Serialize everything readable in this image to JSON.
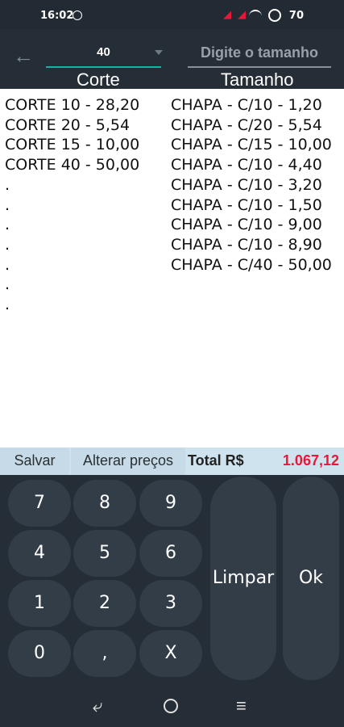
{
  "status": {
    "time": "16:02",
    "battery": "70"
  },
  "topbar": {
    "back_icon": "arrow-left-icon",
    "selected_value": "40",
    "size_placeholder": "Digite o tamanho"
  },
  "headers": {
    "corte": "Corte",
    "tamanho": "Tamanho"
  },
  "corte_items": [
    "CORTE 10 - 28,20",
    "CORTE 20 - 5,54",
    "CORTE 15 - 10,00",
    "CORTE 40 - 50,00",
    ".",
    ".",
    ".",
    ".",
    ".",
    ".",
    "."
  ],
  "tamanho_items": [
    "CHAPA - C/10 - 1,20",
    "CHAPA - C/20 - 5,54",
    "CHAPA - C/15 - 10,00",
    "CHAPA - C/10 - 4,40",
    "CHAPA - C/10 - 3,20",
    "CHAPA - C/10 - 1,50",
    "CHAPA - C/10 - 9,00",
    "CHAPA - C/10 - 8,90",
    "CHAPA - C/40 - 50,00"
  ],
  "actions": {
    "salvar": "Salvar",
    "alterar": "Alterar preços",
    "total_label": "Total R$",
    "total_value": "1.067,12"
  },
  "keypad": {
    "keys": [
      "7",
      "8",
      "9",
      "4",
      "5",
      "6",
      "1",
      "2",
      "3",
      "0",
      ",",
      "X"
    ],
    "limpar": "Limpar",
    "ok": "Ok"
  }
}
